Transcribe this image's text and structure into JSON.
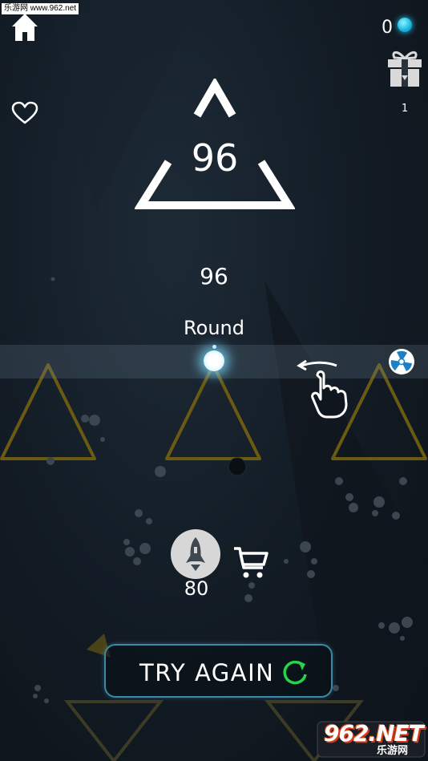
{
  "watermark": "乐游网 www.962.net",
  "hud": {
    "gem_count": "0",
    "gift_count": "1",
    "gem_icon": "cyan-orb"
  },
  "logo": {
    "score": "96"
  },
  "best_score": "96",
  "round_label": "Round",
  "rocket": {
    "price": "80"
  },
  "try_again": {
    "label": "TRY AGAIN"
  },
  "corner_logo": {
    "brand": "962.NET",
    "sub": "乐游网"
  },
  "colors": {
    "background": "#121b24",
    "outline_yellow": "#6a5a12",
    "button_border": "#3d88a6",
    "refresh_green": "#27d34b",
    "gem_cyan": "#29c9f0"
  }
}
